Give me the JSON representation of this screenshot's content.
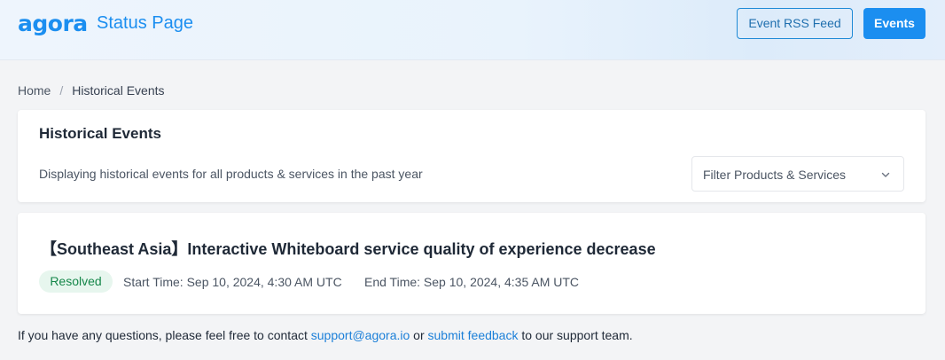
{
  "header": {
    "logo_text": "agora",
    "title": "Status Page",
    "rss_button": "Event RSS Feed",
    "events_button": "Events",
    "accent_color": "#1b8ef0"
  },
  "breadcrumb": {
    "home": "Home",
    "separator": "/",
    "current": "Historical Events"
  },
  "summary": {
    "title": "Historical Events",
    "description": "Displaying historical events for all products & services in the past year",
    "filter_label": "Filter Products & Services",
    "filter_icon": "chevron-down-icon"
  },
  "events": [
    {
      "title": "【Southeast Asia】Interactive Whiteboard service quality of experience decrease",
      "status": "Resolved",
      "status_color": "#16874a",
      "start_time": "Start Time: Sep 10, 2024, 4:30 AM UTC",
      "end_time": "End Time: Sep 10, 2024, 4:35 AM UTC"
    }
  ],
  "footer": {
    "text_before": "If you have any questions, please feel free to contact ",
    "email_link": "support@agora.io",
    "text_middle": " or ",
    "feedback_link": "submit feedback",
    "text_after": " to our support team."
  }
}
